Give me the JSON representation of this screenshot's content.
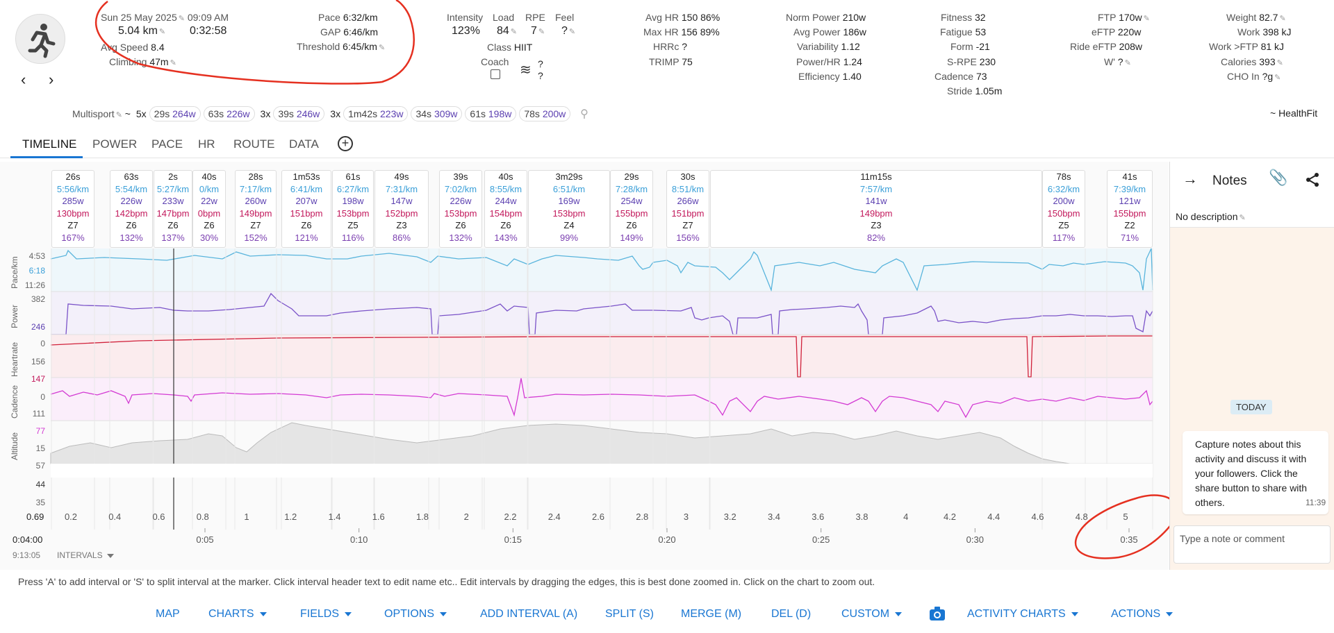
{
  "header": {
    "date": "Sun 25 May 2025",
    "time": "09:09 AM",
    "distance": "5.04 km",
    "duration": "0:32:58",
    "avg_speed_label": "Avg Speed",
    "avg_speed": "8.4",
    "climbing_label": "Climbing",
    "climbing": "47m",
    "pace_label": "Pace",
    "pace": "6:32/km",
    "gap_label": "GAP",
    "gap": "6:46/km",
    "threshold_label": "Threshold",
    "threshold": "6:45/km",
    "intensity_label": "Intensity",
    "intensity": "123%",
    "load_label": "Load",
    "load": "84",
    "rpe_label": "RPE",
    "rpe": "7",
    "feel_label": "Feel",
    "feel": "?",
    "class_label": "Class",
    "class_val": "HIIT",
    "coach_label": "Coach",
    "wind_top": "?",
    "wind_bottom": "?",
    "avg_hr_label": "Avg HR",
    "avg_hr": "150",
    "avg_hr_pct": "86%",
    "max_hr_label": "Max HR",
    "max_hr": "156",
    "max_hr_pct": "89%",
    "hrrc_label": "HRRc",
    "hrrc": "?",
    "trimp_label": "TRIMP",
    "trimp": "75",
    "norm_power_label": "Norm Power",
    "norm_power": "210w",
    "avg_power_label": "Avg Power",
    "avg_power": "186w",
    "variability_label": "Variability",
    "variability": "1.12",
    "power_hr_label": "Power/HR",
    "power_hr": "1.24",
    "efficiency_label": "Efficiency",
    "efficiency": "1.40",
    "fitness_label": "Fitness",
    "fitness": "32",
    "fatigue_label": "Fatigue",
    "fatigue": "53",
    "form_label": "Form",
    "form": "-21",
    "srpe_label": "S-RPE",
    "srpe": "230",
    "cadence_label": "Cadence",
    "cadence": "73",
    "stride_label": "Stride",
    "stride": "1.05m",
    "ftp_label": "FTP",
    "ftp": "170w",
    "eftp_label": "eFTP",
    "eftp": "220w",
    "ride_eftp_label": "Ride eFTP",
    "ride_eftp": "208w",
    "wprime_label": "W'",
    "wprime": "?",
    "weight_label": "Weight",
    "weight": "82.7",
    "work_label": "Work",
    "work": "398 kJ",
    "work_ftp_label": "Work >FTP",
    "work_ftp": "81 kJ",
    "calories_label": "Calories",
    "calories": "393",
    "cho_label": "CHO In",
    "cho": "?g"
  },
  "sport_line": {
    "sport": "Multisport",
    "prefix": "~",
    "groups": [
      {
        "count": "5x",
        "dur": "29s",
        "watts": "264w"
      },
      {
        "count": "",
        "dur": "63s",
        "watts": "226w"
      },
      {
        "count": "3x",
        "dur": "39s",
        "watts": "246w"
      },
      {
        "count": "3x",
        "dur": "1m42s",
        "watts": "223w"
      },
      {
        "count": "",
        "dur": "34s",
        "watts": "309w"
      },
      {
        "count": "",
        "dur": "61s",
        "watts": "198w"
      },
      {
        "count": "",
        "dur": "78s",
        "watts": "200w"
      }
    ],
    "healthfit": "~ HealthFit"
  },
  "tabs": [
    "TIMELINE",
    "POWER",
    "PACE",
    "HR",
    "ROUTE",
    "DATA"
  ],
  "intervals": [
    {
      "t": "26s",
      "p": "5:56/km",
      "w": "285w",
      "h": "130bpm",
      "z": "Z7",
      "pc": "167%"
    },
    {
      "t": "63s",
      "p": "5:54/km",
      "w": "226w",
      "h": "142bpm",
      "z": "Z6",
      "pc": "132%"
    },
    {
      "t": "2s",
      "p": "5:27/km",
      "w": "233w",
      "h": "147bpm",
      "z": "Z6",
      "pc": "137%"
    },
    {
      "t": "40s",
      "p": "0/km",
      "w": "22w",
      "h": "0bpm",
      "z": "Z6",
      "pc": "30%"
    },
    {
      "t": "28s",
      "p": "7:17/km",
      "w": "260w",
      "h": "149bpm",
      "z": "Z7",
      "pc": "152%"
    },
    {
      "t": "1m53s",
      "p": "6:41/km",
      "w": "207w",
      "h": "151bpm",
      "z": "Z6",
      "pc": "121%"
    },
    {
      "t": "61s",
      "p": "6:27/km",
      "w": "198w",
      "h": "153bpm",
      "z": "Z5",
      "pc": "116%"
    },
    {
      "t": "49s",
      "p": "7:31/km",
      "w": "147w",
      "h": "152bpm",
      "z": "Z3",
      "pc": "86%"
    },
    {
      "t": "39s",
      "p": "7:02/km",
      "w": "226w",
      "h": "153bpm",
      "z": "Z6",
      "pc": "132%"
    },
    {
      "t": "40s",
      "p": "8:55/km",
      "w": "244w",
      "h": "154bpm",
      "z": "Z6",
      "pc": "143%"
    },
    {
      "t": "3m29s",
      "p": "6:51/km",
      "w": "169w",
      "h": "153bpm",
      "z": "Z4",
      "pc": "99%"
    },
    {
      "t": "29s",
      "p": "7:28/km",
      "w": "254w",
      "h": "155bpm",
      "z": "Z6",
      "pc": "149%"
    },
    {
      "t": "30s",
      "p": "8:51/km",
      "w": "266w",
      "h": "151bpm",
      "z": "Z7",
      "pc": "156%"
    },
    {
      "t": "11m15s",
      "p": "7:57/km",
      "w": "141w",
      "h": "149bpm",
      "z": "Z3",
      "pc": "82%"
    },
    {
      "t": "78s",
      "p": "6:32/km",
      "w": "200w",
      "h": "150bpm",
      "z": "Z5",
      "pc": "117%"
    },
    {
      "t": "41s",
      "p": "7:39/km",
      "w": "121w",
      "h": "155bpm",
      "z": "Z2",
      "pc": "71%"
    }
  ],
  "rows": {
    "pace": {
      "label": "Pace/km",
      "top": "4:53",
      "mid": "6:18",
      "bot": "11:26"
    },
    "power": {
      "label": "Power",
      "top": "382",
      "mid": "246",
      "bot": "0"
    },
    "hr": {
      "label": "Heartrate",
      "top": "156",
      "mid": "147",
      "bot": "0"
    },
    "cadence": {
      "label": "Cadence",
      "top": "111",
      "mid": "77",
      "bot": "15"
    },
    "altitude": {
      "label": "Altitude",
      "top": "57",
      "mid": "44",
      "bot": "35"
    }
  },
  "chart_data": {
    "type": "line",
    "x_distance_km": {
      "start": "0.69",
      "ticks": [
        "0.2",
        "0.4",
        "0.6",
        "0.8",
        "1",
        "1.2",
        "1.4",
        "1.6",
        "1.8",
        "2",
        "2.2",
        "2.4",
        "2.6",
        "2.8",
        "3",
        "3.2",
        "3.4",
        "3.6",
        "3.8",
        "4",
        "4.2",
        "4.4",
        "4.6",
        "4.8",
        "5"
      ]
    },
    "x_time": {
      "start": "0:04:00",
      "sub": "9:13:05",
      "ticks": [
        "0:05",
        "0:10",
        "0:15",
        "0:20",
        "0:25",
        "0:30",
        "0:35"
      ]
    }
  },
  "intervals_toggle": "INTERVALS",
  "notes": {
    "title": "Notes",
    "description": "No description",
    "today": "TODAY",
    "message": "Capture notes about this activity and discuss it with your followers. Click the share button to share with others.",
    "msg_time": "11:39",
    "placeholder": "Type a note or comment"
  },
  "help_text": "Press 'A' to add interval or 'S' to split interval at the marker. Click interval header text to edit name etc.. Edit intervals by dragging the edges, this is best done zoomed in. Click on the chart to zoom out.",
  "actions": {
    "map": "MAP",
    "charts": "CHARTS",
    "fields": "FIELDS",
    "options": "OPTIONS",
    "add": "ADD INTERVAL (A)",
    "split": "SPLIT (S)",
    "merge": "MERGE (M)",
    "del": "DEL (D)",
    "custom": "CUSTOM",
    "activity_charts": "ACTIVITY CHARTS",
    "actions": "ACTIONS"
  },
  "colors": {
    "accent": "#1976d2",
    "pace": "#3a9fd8",
    "power": "#5b3fb0",
    "hr": "#c2185b",
    "cadence": "#d33ad3",
    "annotation": "#e53020"
  }
}
